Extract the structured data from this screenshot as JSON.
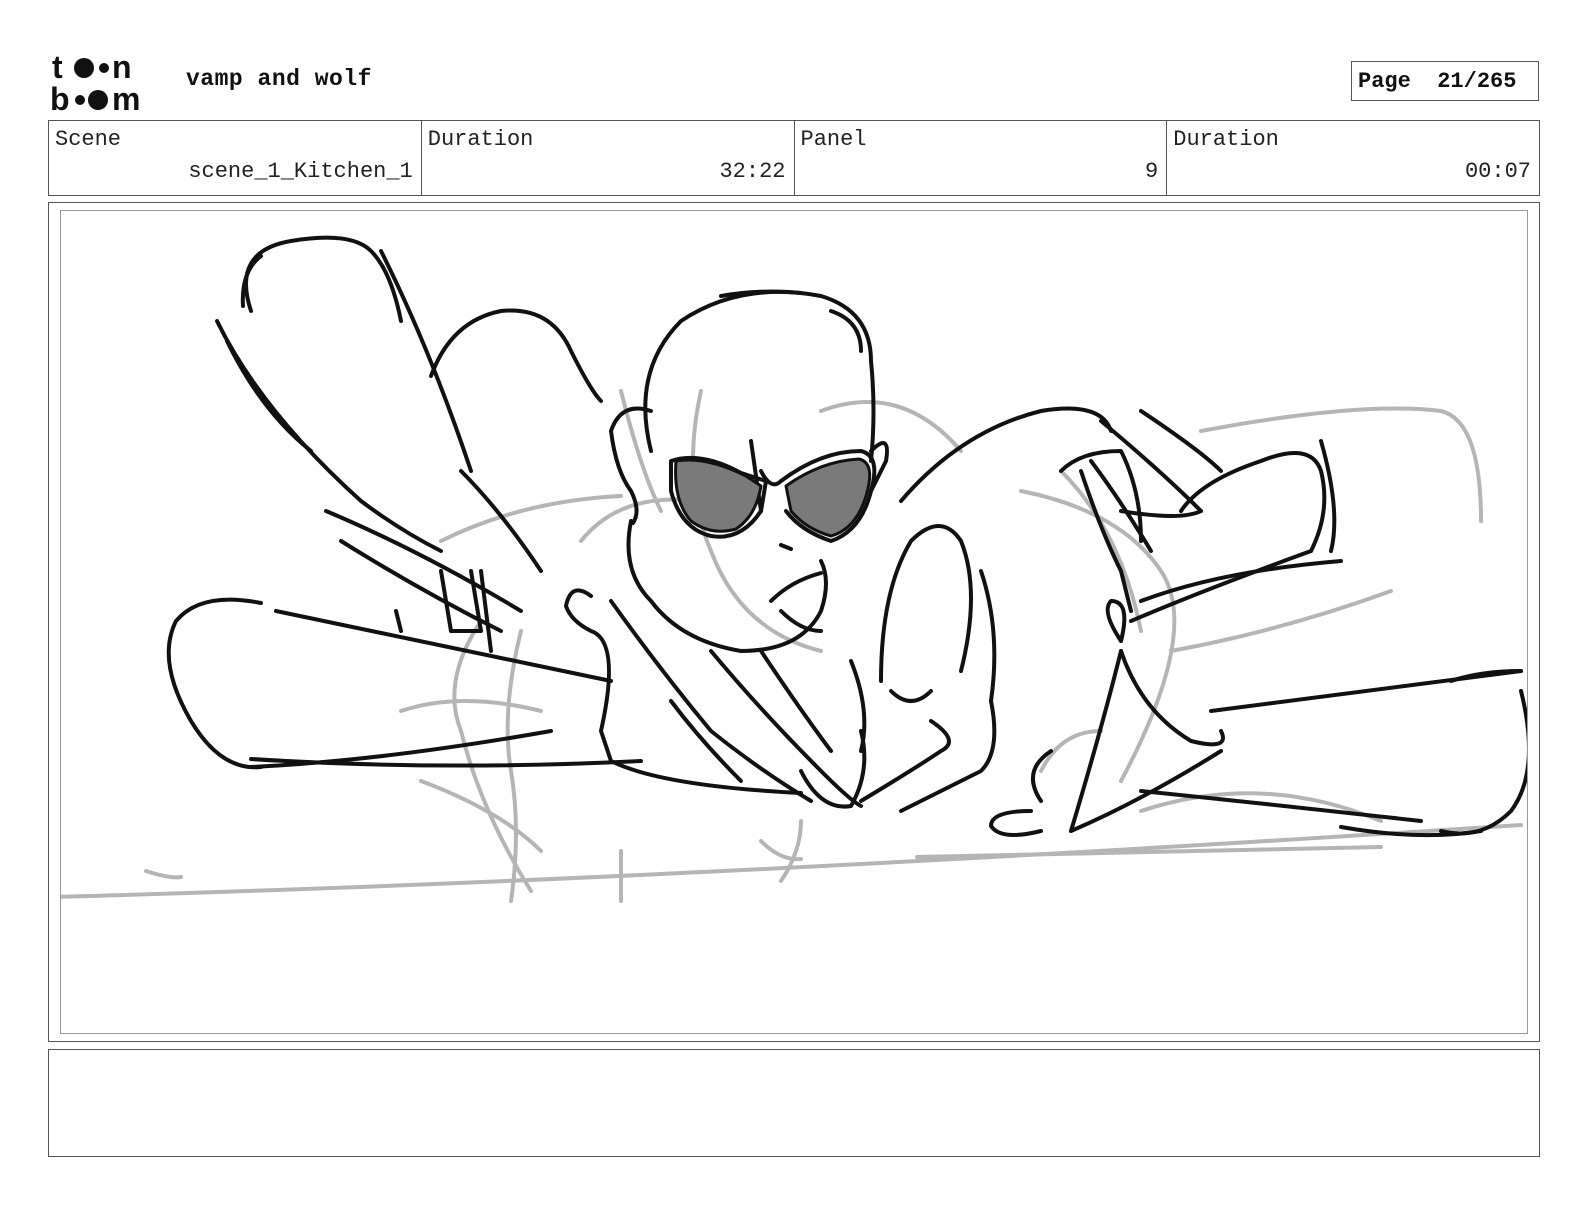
{
  "header": {
    "logo_text": "toon boom",
    "project_title": "vamp and wolf",
    "page_label": "Page",
    "page_number": "21/265"
  },
  "info": {
    "scene_label": "Scene",
    "scene_value": "scene_1_Kitchen_1",
    "scene_duration_label": "Duration",
    "scene_duration_value": "32:22",
    "panel_label": "Panel",
    "panel_value": "9",
    "panel_duration_label": "Duration",
    "panel_duration_value": "00:07"
  },
  "notes": {
    "text": ""
  },
  "colors": {
    "ink": "#111111",
    "sketch_gray": "#b5b5b5",
    "lens_fill": "#7a7a7a",
    "border": "#555555"
  }
}
